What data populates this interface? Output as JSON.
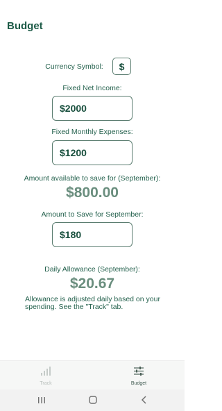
{
  "header": {
    "title": "Budget"
  },
  "currency": {
    "label": "Currency Symbol:",
    "value": "$"
  },
  "income": {
    "label": "Fixed Net Income:",
    "value": "$2000"
  },
  "expenses": {
    "label": "Fixed Monthly Expenses:",
    "value": "$1200"
  },
  "available": {
    "label": "Amount available to save for (September):",
    "amount": "$800.00"
  },
  "save": {
    "label": "Amount to Save for September:",
    "value": "$180"
  },
  "allowance": {
    "label": "Daily Allowance (September):",
    "amount": "$20.67",
    "note": "Allowance is adjusted daily based on your spending. See the \"Track\" tab."
  },
  "bottom_nav": {
    "items": [
      {
        "label": "Track",
        "icon": "bar-chart-icon",
        "active": false
      },
      {
        "label": "Budget",
        "icon": "sliders-icon",
        "active": true
      }
    ]
  },
  "system_nav": {
    "icons": [
      "recent-apps-icon",
      "home-icon",
      "back-icon"
    ]
  },
  "colors": {
    "primary": "#1c5a46",
    "amount": "#6a8e7e",
    "inactive": "#b8bfbc"
  }
}
